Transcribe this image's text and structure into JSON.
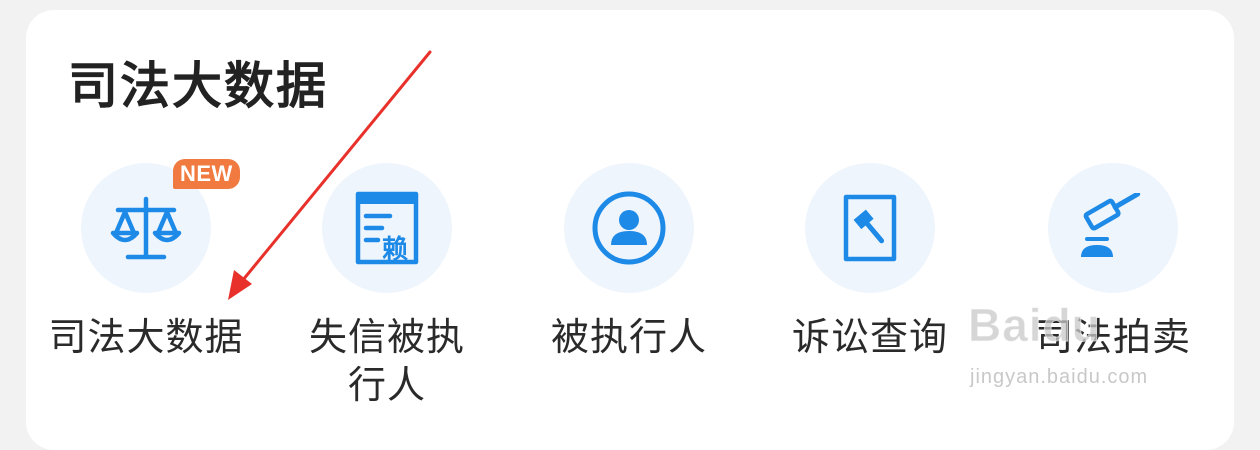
{
  "section": {
    "title": "司法大数据"
  },
  "tiles": [
    {
      "label": "司法大数据",
      "icon": "scales-icon",
      "badge": "NEW"
    },
    {
      "label": "失信被执行人",
      "icon": "dishonest-list-icon",
      "icon_text": "赖"
    },
    {
      "label": "被执行人",
      "icon": "person-icon"
    },
    {
      "label": "诉讼查询",
      "icon": "document-gavel-icon"
    },
    {
      "label": "司法拍卖",
      "icon": "gavel-icon"
    }
  ],
  "watermark": {
    "logo": "Baidu",
    "url": "jingyan.baidu.com"
  },
  "colors": {
    "icon_blue": "#1d8ae8",
    "icon_bg": "#eef5fd",
    "badge": "#f07a3f",
    "arrow": "#e8312a"
  }
}
